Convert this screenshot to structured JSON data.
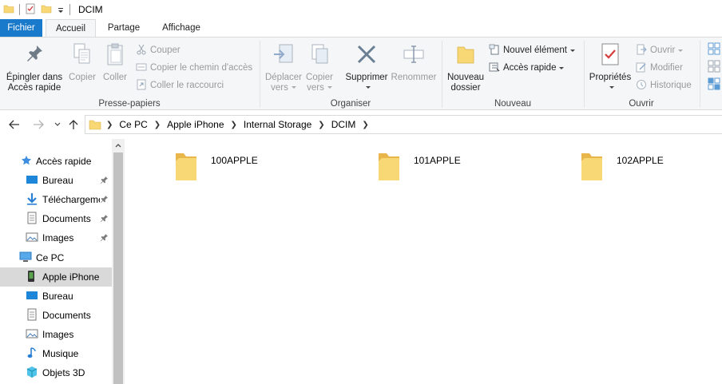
{
  "window": {
    "title": "DCIM"
  },
  "tabs": {
    "file": "Fichier",
    "home": "Accueil",
    "share": "Partage",
    "view": "Affichage"
  },
  "ribbon": {
    "clipboard": {
      "label": "Presse-papiers",
      "pin_line1": "Épingler dans",
      "pin_line2": "Accès rapide",
      "copy": "Copier",
      "paste": "Coller",
      "cut": "Couper",
      "copy_path": "Copier le chemin d'accès",
      "paste_shortcut": "Coller le raccourci"
    },
    "organize": {
      "label": "Organiser",
      "move_line1": "Déplacer",
      "move_line2": "vers",
      "copyto_line1": "Copier",
      "copyto_line2": "vers",
      "delete": "Supprimer",
      "rename": "Renommer"
    },
    "new": {
      "label": "Nouveau",
      "new_folder_line1": "Nouveau",
      "new_folder_line2": "dossier",
      "new_item": "Nouvel élément",
      "quick_access": "Accès rapide"
    },
    "open": {
      "label": "Ouvrir",
      "properties": "Propriétés",
      "open": "Ouvrir",
      "edit": "Modifier",
      "history": "Historique"
    }
  },
  "address": {
    "breadcrumbs": [
      "Ce PC",
      "Apple iPhone",
      "Internal Storage",
      "DCIM"
    ]
  },
  "nav": {
    "quick_access": "Accès rapide",
    "qa_items": [
      "Bureau",
      "Téléchargements",
      "Documents",
      "Images"
    ],
    "this_pc": "Ce PC",
    "pc_items": [
      "Apple iPhone",
      "Bureau",
      "Documents",
      "Images",
      "Musique",
      "Objets 3D"
    ]
  },
  "content": {
    "folders": [
      "100APPLE",
      "101APPLE",
      "102APPLE"
    ]
  },
  "colors": {
    "accent": "#1979ca",
    "folder": "#f8d775",
    "selection": "#d9d9d9"
  }
}
